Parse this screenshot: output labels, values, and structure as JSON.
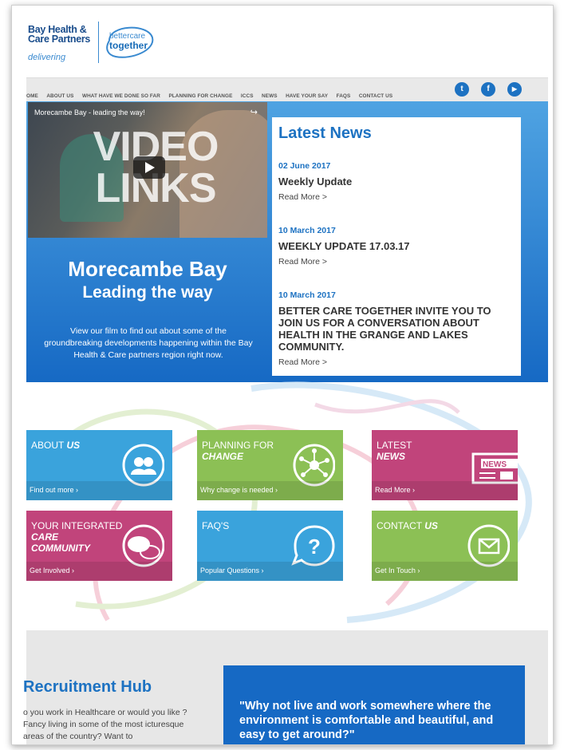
{
  "header": {
    "logo_line1": "Bay Health &",
    "logo_line2": "Care Partners",
    "logo_line3": "delivering",
    "logo_bc1": "bettercare",
    "logo_bc2": "together"
  },
  "nav": {
    "items": [
      "OME",
      "ABOUT US",
      "WHAT HAVE WE DONE SO FAR",
      "PLANNING FOR CHANGE",
      "ICCS",
      "NEWS",
      "HAVE YOUR SAY",
      "FAQS",
      "CONTACT US"
    ],
    "social": [
      {
        "icon": "twitter-icon",
        "glyph": "t"
      },
      {
        "icon": "facebook-icon",
        "glyph": "f"
      },
      {
        "icon": "youtube-icon",
        "glyph": "▶"
      }
    ]
  },
  "hero": {
    "video_title": "Morecambe Bay - leading the way!",
    "video_overlay": "VIDEO LINKS",
    "title": "Morecambe Bay",
    "subtitle": "Leading the way",
    "text": "View our film to find out about some of the groundbreaking developments happening within the Bay Health & Care partners region right now."
  },
  "news": {
    "heading": "Latest News",
    "items": [
      {
        "date": "02 June 2017",
        "title": "Weekly Update",
        "more": "Read More >"
      },
      {
        "date": "10 March 2017",
        "title": "WEEKLY UPDATE 17.03.17",
        "more": "Read More >"
      },
      {
        "date": "10 March 2017",
        "title": "BETTER CARE TOGETHER INVITE YOU TO JOIN US FOR A CONVERSATION ABOUT HEALTH IN THE GRANGE AND LAKES COMMUNITY.",
        "more": "Read More >"
      }
    ]
  },
  "tiles": [
    {
      "line1": "ABOUT",
      "line2": "US",
      "link": "Find out more ›",
      "color": "#3aa3dc",
      "icon": "people-icon"
    },
    {
      "line1": "PLANNING FOR",
      "line2": "CHANGE",
      "link": "Why change is needed ›",
      "color": "#8cc055",
      "icon": "network-icon"
    },
    {
      "line1": "LATEST",
      "line2": "NEWS",
      "link": "Read More ›",
      "color": "#c1447b",
      "icon": "newspaper-icon"
    },
    {
      "line1": "YOUR INTEGRATED",
      "line2": "CARE COMMUNITY",
      "link": "Get Involved ›",
      "color": "#c1447b",
      "icon": "chat-bubbles-icon"
    },
    {
      "line1": "FAQ'S",
      "line2": "",
      "link": "Popular Questions ›",
      "color": "#3aa3dc",
      "icon": "question-icon"
    },
    {
      "line1": "CONTACT",
      "line2": "US",
      "link": "Get In Touch ›",
      "color": "#8cc055",
      "icon": "envelope-icon"
    }
  ],
  "recruitment": {
    "heading": "Recruitment Hub",
    "text": "o you work in Healthcare or would you like ? Fancy living in some of the most icturesque areas of the country? Want to",
    "quote": "\"Why not live and work somewhere where the environment is comfortable and beautiful, and easy to get around?\""
  }
}
